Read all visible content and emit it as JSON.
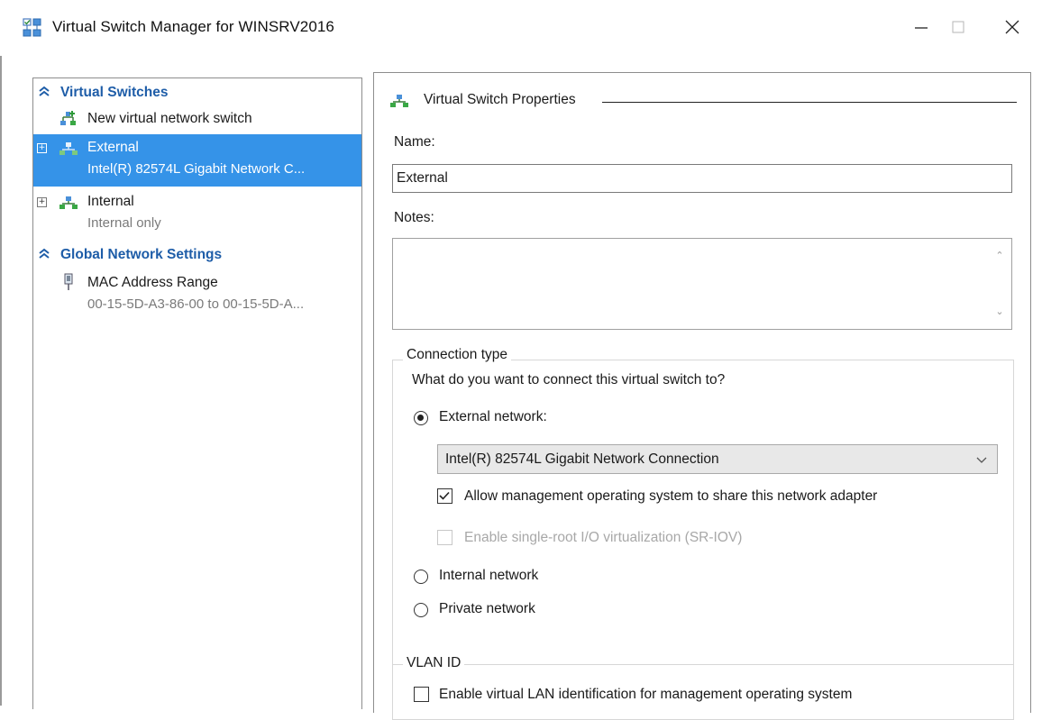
{
  "window": {
    "title": "Virtual Switch Manager for WINSRV2016",
    "icon": "virtual-switch-manager-icon",
    "controls": [
      "minimize",
      "maximize",
      "close"
    ]
  },
  "tree": {
    "virtual_switches_header": "Virtual Switches",
    "new_switch_label": "New virtual network switch",
    "switches": [
      {
        "name": "External",
        "detail": "Intel(R) 82574L Gigabit Network C...",
        "selected": true
      },
      {
        "name": "Internal",
        "detail": "Internal only",
        "selected": false
      }
    ],
    "global_header": "Global Network Settings",
    "mac_range": {
      "label": "MAC Address Range",
      "detail": "00-15-5D-A3-86-00 to 00-15-5D-A..."
    }
  },
  "properties": {
    "section_title": "Virtual Switch Properties",
    "name_label": "Name:",
    "name_value": "External",
    "notes_label": "Notes:",
    "notes_value": "",
    "connection": {
      "group_title": "Connection type",
      "question": "What do you want to connect this virtual switch to?",
      "external_label": "External network:",
      "adapter_selected": "Intel(R) 82574L Gigabit Network Connection",
      "allow_mgmt_label": "Allow management operating system to share this network adapter",
      "allow_mgmt_checked": true,
      "sriov_label": "Enable single-root I/O virtualization (SR-IOV)",
      "sriov_checked": false,
      "internal_label": "Internal network",
      "private_label": "Private network",
      "selected_type": "External network"
    },
    "vlan": {
      "group_title": "VLAN ID",
      "enable_label": "Enable virtual LAN identification for management operating system",
      "enable_checked": false
    }
  },
  "colors": {
    "selection": "#3593e8",
    "header_text": "#1e5da8",
    "disabled_text": "#a8a8a8"
  }
}
